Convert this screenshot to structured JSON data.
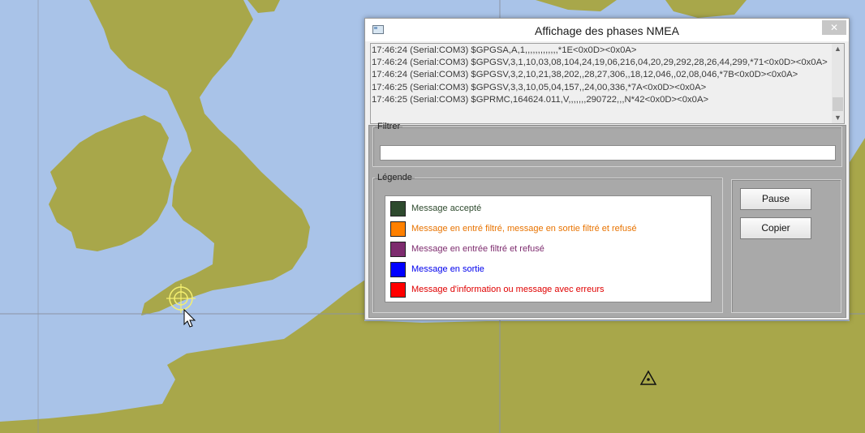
{
  "dialog": {
    "title": "Affichage des phases NMEA",
    "close_glyph": "✕",
    "log_lines": [
      "17:46:24 (Serial:COM3) $GPGSA,A,1,,,,,,,,,,,,,*1E<0x0D><0x0A>",
      "17:46:24 (Serial:COM3) $GPGSV,3,1,10,03,08,104,24,19,06,216,04,20,29,292,28,26,44,299,*71<0x0D><0x0A>",
      "17:46:24 (Serial:COM3) $GPGSV,3,2,10,21,38,202,,28,27,306,,18,12,046,,02,08,046,*7B<0x0D><0x0A>",
      "17:46:25 (Serial:COM3) $GPGSV,3,3,10,05,04,157,,24,00,336,*7A<0x0D><0x0A>",
      "17:46:25 (Serial:COM3) $GPRMC,164624.011,V,,,,,,,290722,,,N*42<0x0D><0x0A>"
    ],
    "filter": {
      "label": "Filtrer",
      "value": ""
    },
    "legend": {
      "label": "Légende",
      "items": [
        {
          "label": "Message accepté",
          "color": "#2e4a2e",
          "text_color": "#2e4a2e"
        },
        {
          "label": "Message en entré filtré, message en sortie filtré et refusé",
          "color": "#ff8000",
          "text_color": "#e87300"
        },
        {
          "label": "Message en entrée filtré et refusé",
          "color": "#7d2b6e",
          "text_color": "#7d2b6e"
        },
        {
          "label": "Message en sortie",
          "color": "#0000ff",
          "text_color": "#0000ee"
        },
        {
          "label": "Message d'information ou message avec erreurs",
          "color": "#ff0000",
          "text_color": "#e00000"
        }
      ]
    },
    "buttons": {
      "pause": "Pause",
      "copy": "Copier"
    }
  },
  "colors": {
    "sea": "#a9c3e8",
    "land": "#a8a74a",
    "grid": "#8a93a3",
    "target": "#f5f070"
  }
}
